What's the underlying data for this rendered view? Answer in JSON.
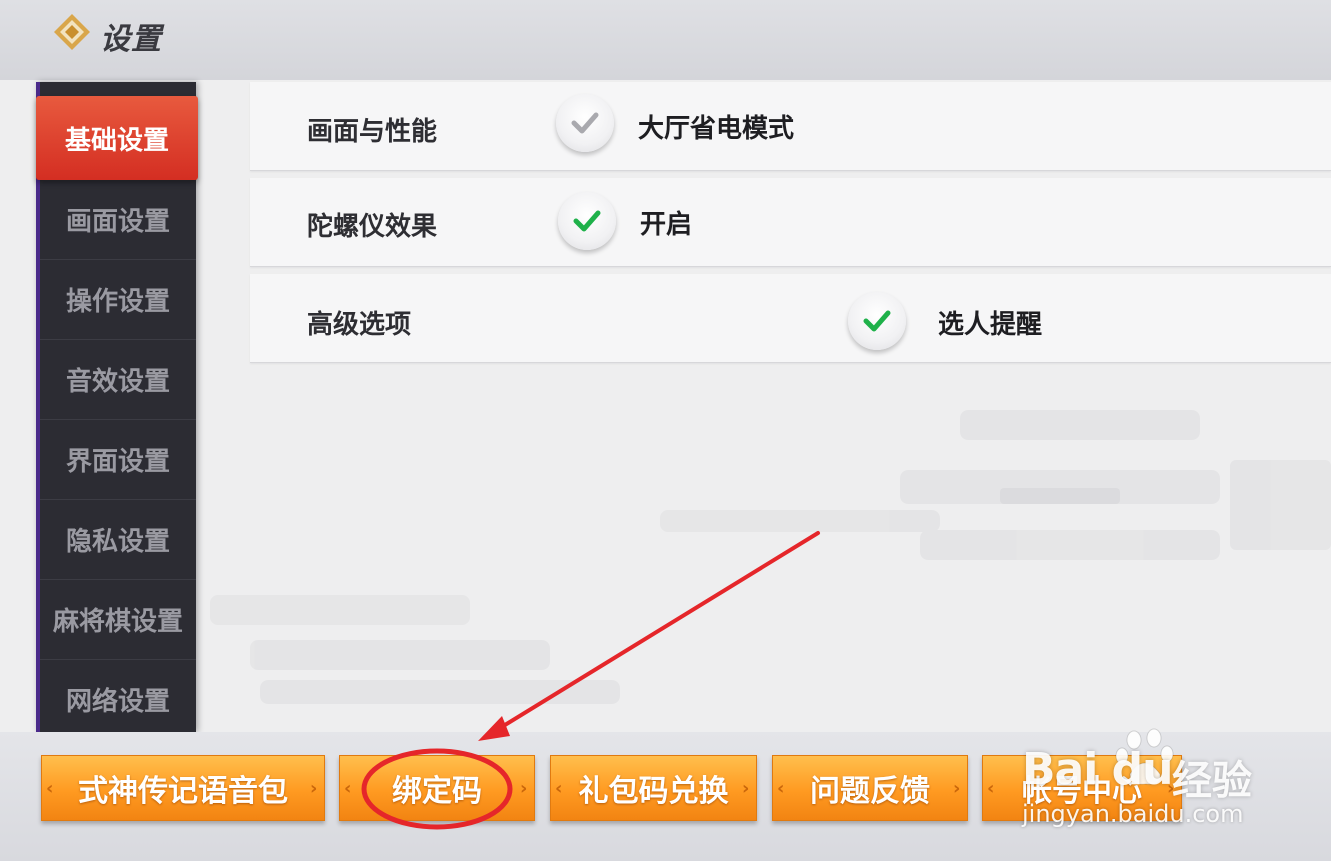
{
  "header": {
    "title": "设置",
    "logo_icon": "diamond-logo-icon"
  },
  "sidebar": {
    "items": [
      {
        "label": "基础设置",
        "active": true
      },
      {
        "label": "画面设置",
        "active": false
      },
      {
        "label": "操作设置",
        "active": false
      },
      {
        "label": "音效设置",
        "active": false
      },
      {
        "label": "界面设置",
        "active": false
      },
      {
        "label": "隐私设置",
        "active": false
      },
      {
        "label": "麻将棋设置",
        "active": false
      },
      {
        "label": "网络设置",
        "active": false
      }
    ]
  },
  "settings": {
    "rows": [
      {
        "label": "画面与性能",
        "option": "大厅省电模式",
        "checked": false
      },
      {
        "label": "陀螺仪效果",
        "option": "开启",
        "checked": true
      },
      {
        "label": "高级选项",
        "option": "选人提醒",
        "checked": true
      }
    ]
  },
  "bottom_buttons": {
    "items": [
      {
        "label": "式神传记语音包"
      },
      {
        "label": "绑定码"
      },
      {
        "label": "礼包码兑换"
      },
      {
        "label": "问题反馈"
      },
      {
        "label": "帐号中心"
      }
    ]
  },
  "watermark": {
    "brand": "Bai du",
    "product": "经验",
    "url": "jingyan.baidu.com"
  },
  "colors": {
    "active_tab": "#d42e22",
    "check_green": "#1fb14a",
    "check_gray": "#a9a9ae",
    "button_orange": "#ff9a21",
    "annotation_red": "#e5262a"
  }
}
